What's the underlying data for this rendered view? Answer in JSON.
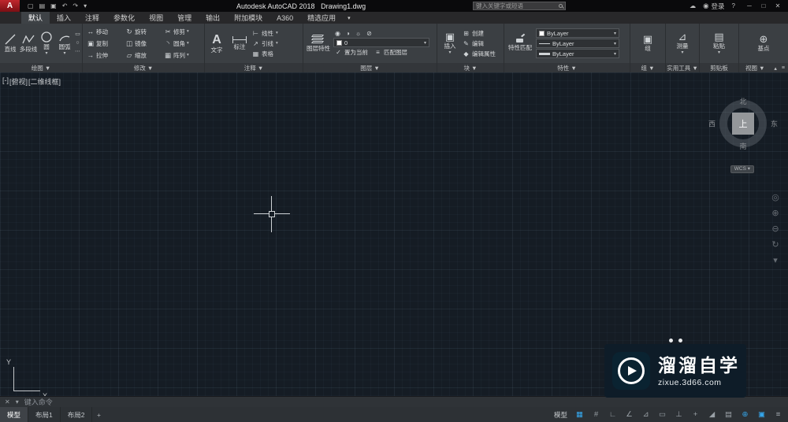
{
  "titlebar": {
    "app_button": "A",
    "qat_icons": [
      {
        "name": "new",
        "glyph": "▢"
      },
      {
        "name": "open",
        "glyph": "▤"
      },
      {
        "name": "save",
        "glyph": "▣"
      },
      {
        "name": "undo",
        "glyph": "↶"
      },
      {
        "name": "redo",
        "glyph": "↷"
      },
      {
        "name": "qat-dropdown",
        "glyph": "▾"
      }
    ],
    "title": "Autodesk AutoCAD 2018   Drawing1.dwg",
    "search_placeholder": "键入关键字或短语",
    "cloud_icon": "☁",
    "signin_label": "登录",
    "person_icon": "◉",
    "help_icon": "?",
    "window": {
      "minimize": "─",
      "maximize": "□",
      "close": "✕"
    }
  },
  "ribbon_tabs": {
    "items": [
      "默认",
      "插入",
      "注释",
      "参数化",
      "视图",
      "管理",
      "输出",
      "附加模块",
      "A360",
      "精选应用"
    ],
    "overflow_icon": "▾"
  },
  "panels": {
    "draw": {
      "footer": "绘图 ▼",
      "items": [
        {
          "label": "直线"
        },
        {
          "label": "多段线"
        },
        {
          "label": "圆",
          "caret": "▾"
        },
        {
          "label": "圆弧",
          "caret": "▾"
        }
      ],
      "extra_icons": [
        {
          "glyph": "▭"
        },
        {
          "glyph": "○"
        },
        {
          "glyph": "⋯"
        }
      ]
    },
    "modify": {
      "footer": "修改 ▼",
      "items": [
        {
          "glyph": "↔",
          "label": "移动"
        },
        {
          "glyph": "↻",
          "label": "旋转"
        },
        {
          "glyph": "✂",
          "label": "修剪",
          "caret": "▾"
        },
        {
          "glyph": "▣",
          "label": "复制"
        },
        {
          "glyph": "◫",
          "label": "镜像"
        },
        {
          "glyph": "◝",
          "label": "圆角",
          "caret": "▾"
        },
        {
          "glyph": "→",
          "label": "拉伸"
        },
        {
          "glyph": "▱",
          "label": "缩放"
        },
        {
          "glyph": "▦",
          "label": "阵列",
          "caret": "▾"
        }
      ]
    },
    "annotate": {
      "footer": "注释 ▼",
      "text_icon": "A",
      "text_label": "文字",
      "dim_label": "标注",
      "items": [
        {
          "glyph": "⊢",
          "label": "线性",
          "caret": "▾"
        },
        {
          "glyph": "↗",
          "label": "引线",
          "caret": "▾"
        },
        {
          "glyph": "▦",
          "label": "表格"
        }
      ]
    },
    "layers": {
      "footer": "图层 ▼",
      "big_label": "图层特性",
      "tool_icons": [
        "◉",
        "◑",
        "☼",
        "⊘"
      ],
      "dropdown_value": "0",
      "dropdown_caret": "▾",
      "items": [
        {
          "glyph": "✓",
          "label": "置为当前"
        },
        {
          "glyph": "≡",
          "label": "匹配图层"
        }
      ]
    },
    "block": {
      "footer": "块 ▼",
      "big_label": "插入",
      "big_glyph": "▣",
      "big_caret": "▾",
      "items": [
        {
          "glyph": "⊞",
          "label": "创建"
        },
        {
          "glyph": "✎",
          "label": "编辑"
        },
        {
          "glyph": "◆",
          "label": "编辑属性"
        }
      ]
    },
    "properties": {
      "footer": "特性 ▼",
      "big_label": "特性匹配",
      "caret": "▾",
      "dropdowns": [
        {
          "value": "ByLayer"
        },
        {
          "value": "ByLayer"
        },
        {
          "value": "ByLayer"
        }
      ]
    },
    "group": {
      "footer": "组 ▼",
      "big_label": "组",
      "glyph": "▣"
    },
    "utilities": {
      "footer": "实用工具 ▼",
      "big_label": "测量",
      "glyph": "⊿",
      "caret": "▾"
    },
    "clipboard": {
      "footer": "剪贴板",
      "big_label": "粘贴",
      "glyph": "▤",
      "caret": "▾"
    },
    "view_panel": {
      "footer": "视图 ▼",
      "big_label": "基点",
      "glyph": "⊕"
    },
    "ribbon_controls": {
      "collapse": "▴",
      "options": "≡"
    }
  },
  "canvas": {
    "viewport_menu": "[-]",
    "view_name": "[俯视]",
    "visual_style": "[二维线框]"
  },
  "viewcube": {
    "up": "上",
    "north": "北",
    "south": "南",
    "east": "东",
    "west": "西",
    "wcs": "WCS ▾"
  },
  "navbar_icons": [
    {
      "name": "navigation-wheel",
      "glyph": "◎"
    },
    {
      "name": "zoom-in",
      "glyph": "⊕"
    },
    {
      "name": "zoom-out",
      "glyph": "⊖"
    },
    {
      "name": "orbit",
      "glyph": "↻"
    },
    {
      "name": "showmotion",
      "glyph": "▾"
    }
  ],
  "ucs": {
    "y_label": "Y",
    "x_label": "X"
  },
  "command_line": {
    "close_icon": "✕",
    "recent_icon": "▾",
    "placeholder": "键入命令"
  },
  "statusbar": {
    "layout_tabs": [
      {
        "label": "模型",
        "active": true
      },
      {
        "label": "布局1",
        "active": false
      },
      {
        "label": "布局2",
        "active": false
      }
    ],
    "new_layout_icon": "+",
    "model_label": "模型",
    "icons": [
      {
        "name": "grid",
        "glyph": "▦",
        "active": true
      },
      {
        "name": "snap-mode",
        "glyph": "#",
        "active": false
      },
      {
        "name": "ortho",
        "glyph": "∟",
        "active": false
      },
      {
        "name": "polar-tracking",
        "glyph": "∠",
        "active": false
      },
      {
        "name": "isometric-drafting",
        "glyph": "⊿",
        "active": false
      },
      {
        "name": "dynamic-input",
        "glyph": "▭",
        "active": false
      },
      {
        "name": "object-snap",
        "glyph": "⊥",
        "active": false
      },
      {
        "name": "object-snap-tracking",
        "glyph": "+",
        "active": false
      },
      {
        "name": "annotation-scale",
        "glyph": "◢",
        "active": false
      },
      {
        "name": "workspace-switching",
        "glyph": "▤",
        "active": false
      },
      {
        "name": "graphics-performance",
        "glyph": "⊕",
        "active": true
      },
      {
        "name": "isolate-objects",
        "glyph": "▣",
        "active": true
      },
      {
        "name": "customization",
        "glyph": "≡",
        "active": false
      }
    ]
  },
  "watermark": {
    "brand": "溜溜自学",
    "url": "zixue.3d66.com"
  }
}
